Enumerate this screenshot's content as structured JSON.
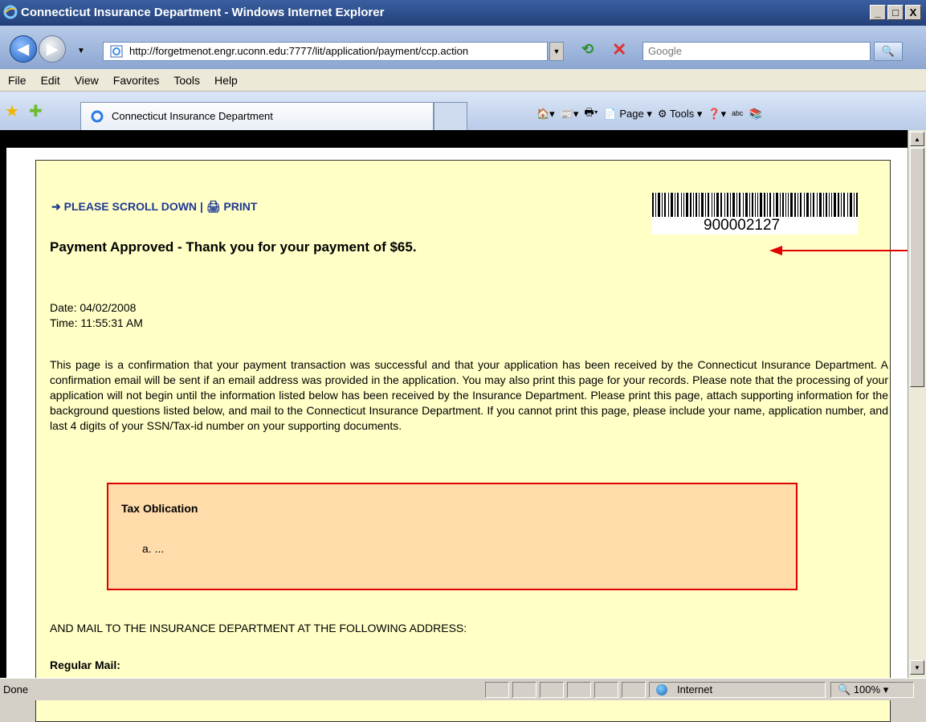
{
  "window": {
    "title": "Connecticut Insurance Department - Windows Internet Explorer",
    "buttons": [
      "_",
      "□",
      "X"
    ]
  },
  "nav": {
    "url": "http://forgetmenot.engr.uconn.edu:7777/lit/application/payment/ccp.action",
    "search_placeholder": "Google"
  },
  "menu": [
    "File",
    "Edit",
    "View",
    "Favorites",
    "Tools",
    "Help"
  ],
  "tabs": {
    "active_label": "Connecticut Insurance Department"
  },
  "commandbar": {
    "page": "Page",
    "tools": "Tools"
  },
  "page": {
    "scroll_down": "PLEASE SCROLL DOWN",
    "print": "PRINT",
    "barcode_number": "900002127",
    "approved_title": "Payment Approved - Thank you for your payment of $65.",
    "date": "Date: 04/02/2008",
    "time": "Time: 11:55:31 AM",
    "paragraph": "This page is a confirmation that your payment transaction was successful and that your application has been received by the Connecticut Insurance Department. A confirmation email will be sent if an email address was provided in the application. You may also print this page for your records. Please note that the processing of your application will not begin until the information listed below has been received by the Insurance Department. Please print this page, attach supporting information for the background questions listed below, and mail to the Connecticut Insurance Department. If you cannot print this page, please include your name, application number, and last 4 digits of your SSN/Tax-id number on your supporting documents.",
    "box_title": "Tax Oblication",
    "box_item": "a.   ...",
    "mail_address": "AND MAIL TO THE INSURANCE DEPARTMENT AT THE FOLLOWING ADDRESS:",
    "regular_mail": "Regular Mail:"
  },
  "status": {
    "text": "Done",
    "zone": "Internet",
    "zoom": "100%"
  },
  "colors": {
    "page_background": "#ffffc6",
    "highlight_box": "#ffdcaa",
    "highlight_border": "#e00000",
    "annotation_arrow": "#e00000",
    "link": "#1f3a93"
  }
}
